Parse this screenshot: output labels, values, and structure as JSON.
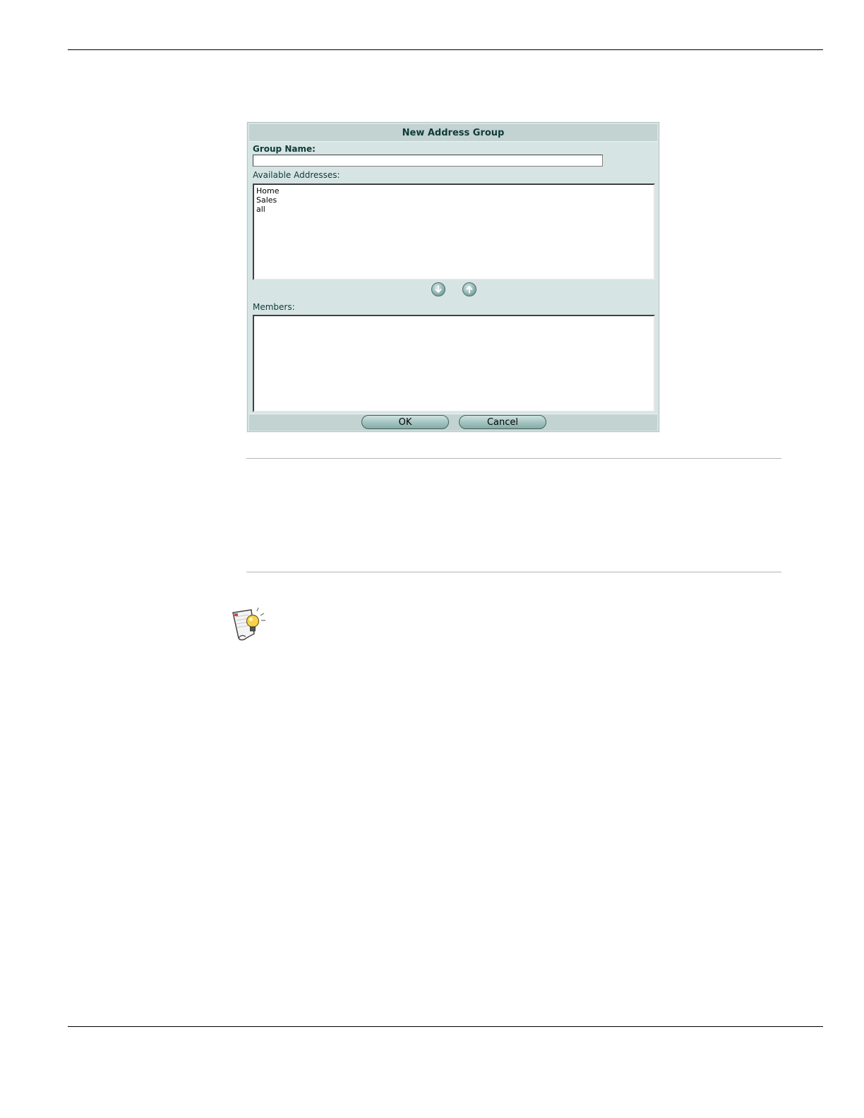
{
  "dialog": {
    "title": "New Address Group",
    "group_name_label": "Group Name:",
    "group_name_value": "",
    "available_label": "Available Addresses:",
    "available_items": [
      "Home",
      "Sales",
      "all"
    ],
    "members_label": "Members:",
    "members_items": [],
    "ok_label": "OK",
    "cancel_label": "Cancel"
  },
  "icons": {
    "move_down": "down-arrow-circle-icon",
    "move_up": "up-arrow-circle-icon",
    "tip": "lightbulb-tip-icon"
  },
  "colors": {
    "dialog_bg": "#d6e5e4",
    "header_bg": "#c3d3d2",
    "title_text": "#0f3a38"
  }
}
